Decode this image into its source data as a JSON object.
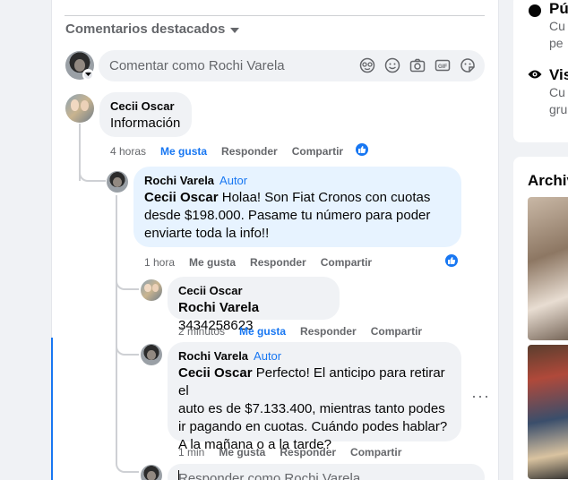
{
  "header": {
    "sort_label": "Comentarios destacados"
  },
  "composer": {
    "placeholder": "Comentar como Rochi Varela"
  },
  "comments": [
    {
      "author": "Cecii Oscar",
      "text": "Información",
      "time": "4 horas",
      "like": "Me gusta",
      "reply": "Responder",
      "share": "Compartir"
    },
    {
      "author": "Rochi Varela",
      "tag": "Autor",
      "mention": "Cecii Oscar",
      "text_lines": [
        " Holaa! Son Fiat Cronos con cuotas",
        "desde $198.000. Pasame tu número para poder",
        "enviarte toda la info!!"
      ],
      "time": "1 hora",
      "like": "Me gusta",
      "reply": "Responder",
      "share": "Compartir"
    },
    {
      "author": "Cecii Oscar",
      "mention": "Rochi Varela",
      "text": " 3434258623",
      "time": "2 minutos",
      "like": "Me gusta",
      "reply": "Responder",
      "share": "Compartir"
    },
    {
      "author": "Rochi Varela",
      "tag": "Autor",
      "mention": "Cecii Oscar",
      "text_lines": [
        " Perfecto! El anticipo para retirar el",
        "auto es de $7.133.400, mientras tanto podes",
        "ir pagando en cuotas. Cuándo podes hablar?",
        "A la mañana o a la tarde?"
      ],
      "time": "1 min",
      "like": "Me gusta",
      "reply": "Responder",
      "share": "Compartir"
    }
  ],
  "reply_composer": {
    "placeholder": "Responder como Rochi Varela"
  },
  "sidebar": {
    "row1_title": "Pú",
    "row1_sub": [
      "Cu",
      "pe"
    ],
    "row2_title": "Vis",
    "row2_sub": [
      "Cu",
      "gru"
    ],
    "archive_title": "Archiv"
  },
  "colors": {
    "accent": "#1877f2",
    "bubble": "#f0f2f5",
    "author_bubble": "#e7f3ff",
    "muted": "#65676b"
  },
  "icons": [
    "chevron-down-icon",
    "emoji-sticker-icon",
    "smiley-icon",
    "camera-icon",
    "gif-icon",
    "sticker-icon",
    "thumbs-up-icon",
    "more-options-icon",
    "eye-icon"
  ]
}
